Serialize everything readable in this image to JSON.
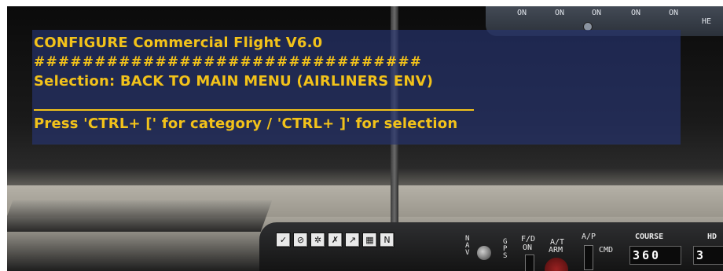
{
  "overhead": {
    "on_labels": [
      "ON",
      "ON",
      "ON",
      "ON",
      "ON"
    ],
    "partial_label": "HE"
  },
  "message": {
    "title": "CONFIGURE Commercial Flight V6.0",
    "hashes": "################################",
    "selection": "Selection: BACK TO MAIN MENU (AIRLINERS ENV)",
    "instructions": "Press 'CTRL+ [' for category / 'CTRL+ ]' for selection",
    "text_color": "#f2c21a",
    "box_color": "#26346e"
  },
  "icon_toolbar": [
    {
      "name": "checkmark-icon",
      "glyph": "✓"
    },
    {
      "name": "no-entry-icon",
      "glyph": "⊘"
    },
    {
      "name": "gear-icon",
      "glyph": "✲"
    },
    {
      "name": "tools-icon",
      "glyph": "✗"
    },
    {
      "name": "chart-icon",
      "glyph": "↗"
    },
    {
      "name": "radio-icon",
      "glyph": "▦"
    },
    {
      "name": "nav-icon",
      "glyph": "N"
    }
  ],
  "mcp": {
    "nav_label": "NAV",
    "gps_label": "GPS",
    "fd_label": "F/D",
    "fd_state": "ON",
    "at_label": "A/T",
    "at_state": "ARM",
    "ap_label": "A/P",
    "cmd_label": "CMD",
    "course_label": "COURSE",
    "course_value": "360",
    "hdg_label": "HD",
    "hdg_value": "3"
  }
}
